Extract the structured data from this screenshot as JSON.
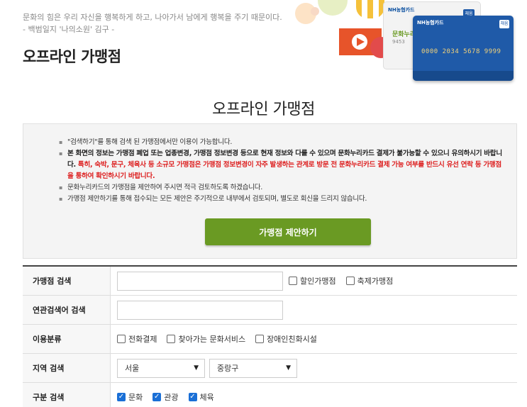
{
  "header": {
    "quote_line1": "문화의 힘은 우리 자신을 행복하게 하고, 나아가서 남에게 행복을 주기 때문이다.",
    "quote_line2": "- 백범일지 '나의소원' 김구 -",
    "page_title": "오프라인 가맹점"
  },
  "hero": {
    "card_brand": "NH농협카드",
    "card_brand2": "NH농협카드",
    "card_number": "0000 2034 5678 9999",
    "card_name": "문화누리",
    "card_badge": "체움",
    "card_badge2": "채움",
    "card_small": "9453",
    "card_label": "문화누리"
  },
  "section_title": "오프라인 가맹점",
  "notice": {
    "items": [
      {
        "text": "\"검색하기\"를 통해 검색 된 가맹점에서만 이용이 가능합니다."
      },
      {
        "bold": "본 화면의 정보는 가맹점 폐업 또는 업종변경, 가맹점 정보변경 등으로 현재 정보와 다를 수 있으며 문화누리카드 결제가 불가능할 수 있으니 유의하시기 바랍니다.",
        "red": " 특히, 숙박, 문구, 체육사 등 소규모 가맹점은 가맹점 정보변경이 자주 발생하는 관계로 방문 전 문화누리카드 결제 가능 여부를 반드시 유선 연락 등 가맹점을 통하여 확인하시기 바랍니다."
      },
      {
        "text": "문화누리카드의 가맹점을 제안하여 주시면 적극 검토하도록 하겠습니다."
      },
      {
        "text": "가맹점 제안하기를 통해 접수되는 모든 제안은 주기적으로 내부에서 검토되며, 별도로 회신을 드리지 않습니다."
      }
    ],
    "suggest_button": "가맹점 제안하기"
  },
  "form": {
    "store_search": {
      "label": "가맹점 검색",
      "value": "",
      "opt1": "할인가맹점",
      "opt2": "축제가맹점"
    },
    "keyword_search": {
      "label": "연관검색어 검색",
      "value": ""
    },
    "usage_type": {
      "label": "이용분류",
      "opt1": "전화결제",
      "opt2": "찾아가는 문화서비스",
      "opt3": "장애인친화시설"
    },
    "region": {
      "label": "지역 검색",
      "city": "서울",
      "district": "중랑구"
    },
    "category": {
      "label": "구분 검색",
      "opt1": "문화",
      "opt2": "관광",
      "opt3": "체육"
    }
  },
  "colors": {
    "accent": "#6a9a23",
    "warning": "#d22222",
    "checkbox": "#1a6fd6"
  }
}
